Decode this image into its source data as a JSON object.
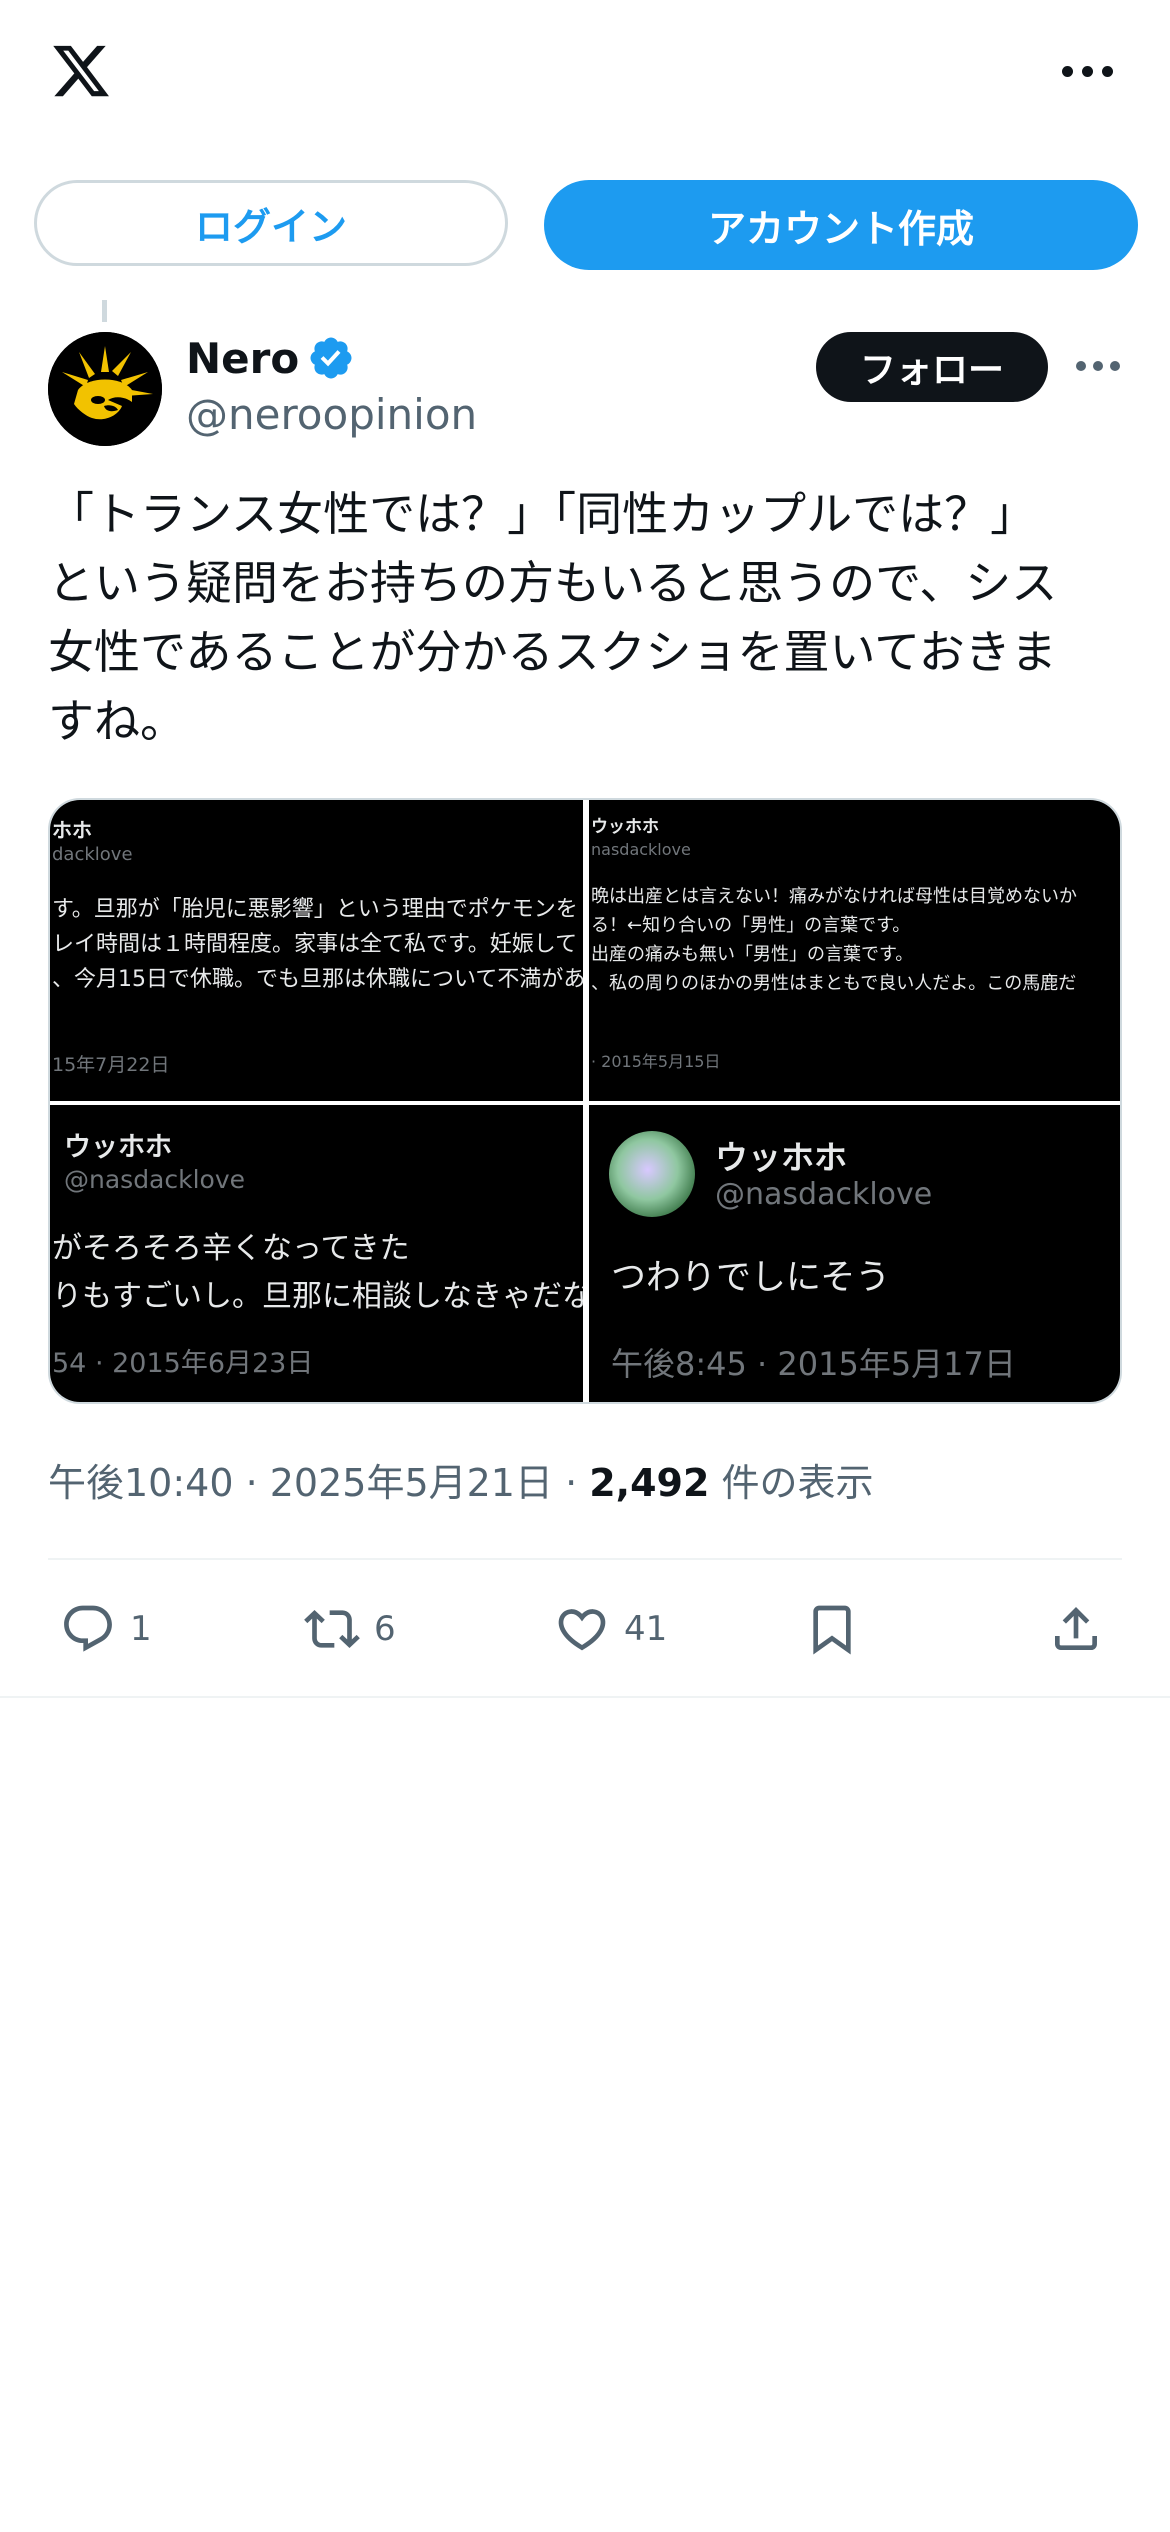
{
  "header": {
    "logo_icon": "x-logo-icon",
    "more_icon": "more-horizontal-icon"
  },
  "auth": {
    "login_label": "ログイン",
    "signup_label": "アカウント作成"
  },
  "post": {
    "author_name": "Nero",
    "author_handle": "@neroopinion",
    "verified_icon": "verified-badge-icon",
    "follow_label": "フォロー",
    "text": "「トランス女性では？」「同性カップルでは？」\nという疑問をお持ちの方もいると思うので、シス\n女性であることが分かるスクショを置いておきま\nすね。",
    "timestamp": "午後10:40 · 2025年5月21日 · ",
    "views_count": "2,492",
    "views_label": " 件の表示"
  },
  "media": [
    {
      "name": "ホホ",
      "handle": "dacklove",
      "text": "す。旦那が「胎児に悪影響」という理由でポケモンを\nレイ時間は１時間程度。家事は全て私です。妊娠して\n、今月15日で休職。でも旦那は休職について不満があ",
      "date": "15年7月22日"
    },
    {
      "name": "ウッホホ",
      "handle": "nasdacklove",
      "text": "晩は出産とは言えない！痛みがなければ母性は目覚めないか\nる！←知り合いの「男性」の言葉です。\n出産の痛みも無い「男性」の言葉です。\n、私の周りのほかの男性はまともで良い人だよ。この馬鹿だ",
      "date": "· 2015年5月15日"
    },
    {
      "name": "ウッホホ",
      "handle": "@nasdacklove",
      "text": "がそろそろ辛くなってきた\nりもすごいし。旦那に相談しなきゃだな。",
      "date": "54 · 2015年6月23日"
    },
    {
      "name": "ウッホホ",
      "handle": "@nasdacklove",
      "text": "つわりでしにそう",
      "date": "午後8:45 · 2015年5月17日"
    }
  ],
  "actions": {
    "reply_icon": "reply-icon",
    "reply_count": "1",
    "retweet_icon": "retweet-icon",
    "retweet_count": "6",
    "like_icon": "heart-icon",
    "like_count": "41",
    "bookmark_icon": "bookmark-icon",
    "share_icon": "share-icon"
  },
  "colors": {
    "accent": "#1d9bf0",
    "text": "#0f1419",
    "secondary": "#536471",
    "border": "#cfd9de"
  }
}
